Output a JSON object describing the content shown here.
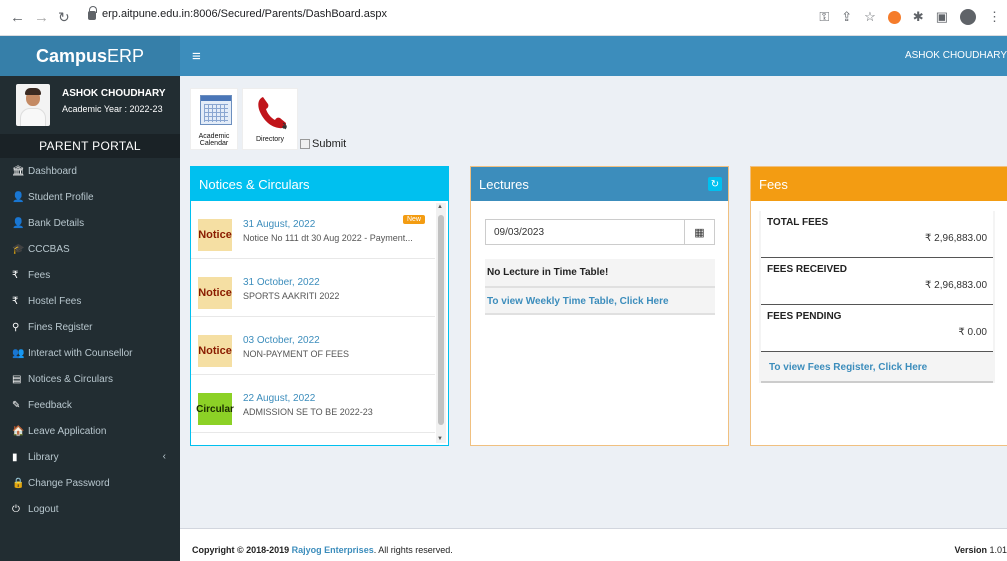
{
  "browser": {
    "url": "erp.aitpune.edu.in:8006/Secured/Parents/DashBoard.aspx",
    "back_icon": "arrow-left-icon",
    "forward_icon": "arrow-right-icon",
    "reload_icon": "reload-icon"
  },
  "app": {
    "brand_bold": "Campus",
    "brand_rest": "ERP",
    "user_top": "ASHOK CHOUDHARY"
  },
  "sidebar": {
    "user_name": "ASHOK CHOUDHARY",
    "academic_year": "Academic Year : 2022-23",
    "portal_label": "PARENT PORTAL",
    "items": [
      {
        "label": "Dashboard",
        "icon": "🏛"
      },
      {
        "label": "Student Profile",
        "icon": "👤"
      },
      {
        "label": "Bank Details",
        "icon": "👤"
      },
      {
        "label": "CCCBAS",
        "icon": "🎓"
      },
      {
        "label": "Fees",
        "icon": "₹"
      },
      {
        "label": "Hostel Fees",
        "icon": "₹"
      },
      {
        "label": "Fines Register",
        "icon": "⚲"
      },
      {
        "label": "Interact with Counsellor",
        "icon": "👥"
      },
      {
        "label": "Notices & Circulars",
        "icon": "▤"
      },
      {
        "label": "Feedback",
        "icon": "✎"
      },
      {
        "label": "Leave Application",
        "icon": "🏠"
      },
      {
        "label": "Library",
        "icon": "▮"
      },
      {
        "label": "Change Password",
        "icon": "🔒"
      },
      {
        "label": "Logout",
        "icon": "⏻"
      }
    ]
  },
  "quick_links": {
    "calendar_label_1": "Academic",
    "calendar_label_2": "Calendar",
    "directory_label": "Directory",
    "submit_alt": "Submit"
  },
  "notices": {
    "title": "Notices & Circulars",
    "new_badge": "New",
    "items": [
      {
        "tag": "Notice",
        "date": "31 August, 2022",
        "title": "Notice No 111 dt 30 Aug 2022 - Payment..."
      },
      {
        "tag": "Notice",
        "date": "31 October, 2022",
        "title": "SPORTS AAKRITI 2022"
      },
      {
        "tag": "Notice",
        "date": "03 October, 2022",
        "title": "NON-PAYMENT OF FEES"
      },
      {
        "tag": "Circular",
        "date": "22 August, 2022",
        "title": "ADMISSION SE TO BE 2022-23"
      }
    ]
  },
  "lectures": {
    "title": "Lectures",
    "date_value": "09/03/2023",
    "message": "No Lecture in Time Table!",
    "link": "To view Weekly Time Table, Click Here"
  },
  "fees": {
    "title": "Fees",
    "total_label": "TOTAL FEES",
    "total_value": "₹ 2,96,883.00",
    "received_label": "FEES RECEIVED",
    "received_value": "₹ 2,96,883.00",
    "pending_label": "FEES PENDING",
    "pending_value": "₹ 0.00",
    "link": "To view Fees Register, Click Here"
  },
  "footer": {
    "copyright": "Copyright © 2018-2019 ",
    "company": "Rajyog Enterprises",
    "rights": ". All rights reserved.",
    "version_label": "Version",
    "version_value": " 1.01"
  }
}
